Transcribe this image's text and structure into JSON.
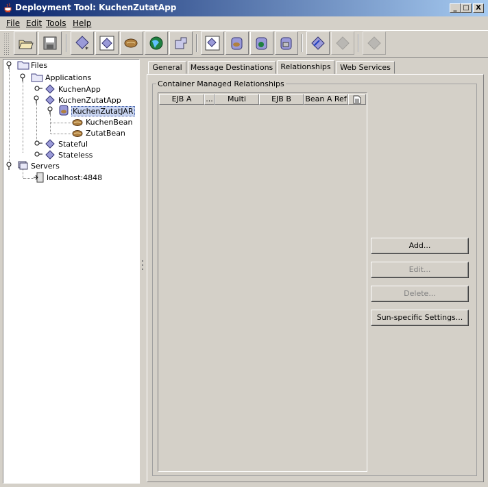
{
  "window": {
    "title": "Deployment Tool: KuchenZutatApp",
    "minimize": "_",
    "maximize": "□",
    "close": "X"
  },
  "menu": {
    "items": [
      "File",
      "Edit",
      "Tools",
      "Help"
    ]
  },
  "toolbar": {
    "buttons": [
      "open-icon",
      "save-icon",
      "new-ejb-icon",
      "new-app-client-icon",
      "new-bean-icon",
      "new-web-icon",
      "new-connector-icon",
      "add-server-icon",
      "add-jar-icon",
      "add-war-icon",
      "add-client-icon",
      "deploy-icon",
      "verify-icon",
      "undeploy-icon"
    ]
  },
  "tree": {
    "files": "Files",
    "applications": "Applications",
    "kuchenapp": "KuchenApp",
    "kuchenzutatapp": "KuchenZutatApp",
    "kuchenzutatjar": "KuchenZutatJAR",
    "kuchenbean": "KuchenBean",
    "zutatbean": "ZutatBean",
    "stateful": "Stateful",
    "stateless": "Stateless",
    "servers": "Servers",
    "localhost": "localhost:4848"
  },
  "tabs": [
    "General",
    "Message Destinations",
    "Relationships",
    "Web Services"
  ],
  "active_tab": "Relationships",
  "panel": {
    "group_title": "Container Managed Relationships",
    "columns": [
      "EJB A",
      "...",
      "Multi",
      "EJB B",
      "Bean A Ref"
    ]
  },
  "buttons": {
    "add": "Add...",
    "edit": "Edit...",
    "delete": "Delete...",
    "sun_settings": "Sun-specific Settings..."
  },
  "colors": {
    "titlebar_start": "#0a246a",
    "titlebar_end": "#a6caf0",
    "face": "#d4d0c8",
    "selection": "#c8d4f0"
  }
}
